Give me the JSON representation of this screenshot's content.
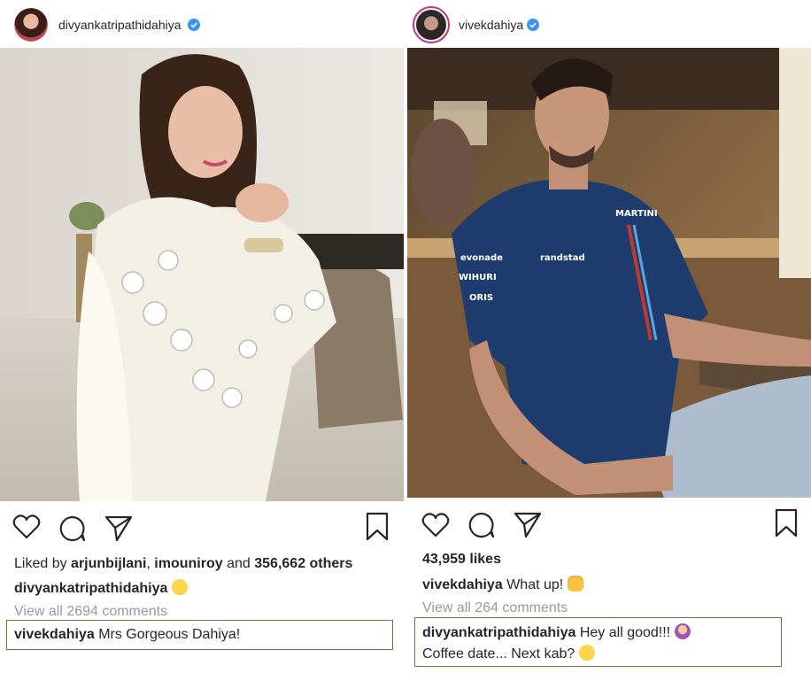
{
  "left_post": {
    "username": "divyankatripathidahiya",
    "likes_prefix": "Liked by",
    "liked_user_1": "arjunbijlani",
    "separator": ",",
    "liked_user_2": "imouniroy",
    "and_text": "and",
    "others_count": "356,662 others",
    "caption_user": "divyankatripathidahiya",
    "caption_text": "",
    "view_comments": "View all 2694 comments",
    "comment_user": "vivekdahiya",
    "comment_text": "Mrs Gorgeous Dahiya!"
  },
  "right_post": {
    "username": "vivekdahiya",
    "likes": "43,959 likes",
    "caption_user": "vivekdahiya",
    "caption_text": "What up!",
    "view_comments": "View all 264 comments",
    "comment_user": "divyankatripathidahiya",
    "comment_text": "Hey all good!!!",
    "comment_line2": "Coffee date... Next kab?"
  },
  "icons": {
    "like": "heart-icon",
    "comment": "comment-bubble-icon",
    "share": "paper-plane-icon",
    "save": "bookmark-icon",
    "verified": "verified-badge-icon"
  },
  "colors": {
    "verified_blue": "#3897f0",
    "muted_text": "#999999",
    "highlight_border": "#8b6a3a"
  }
}
